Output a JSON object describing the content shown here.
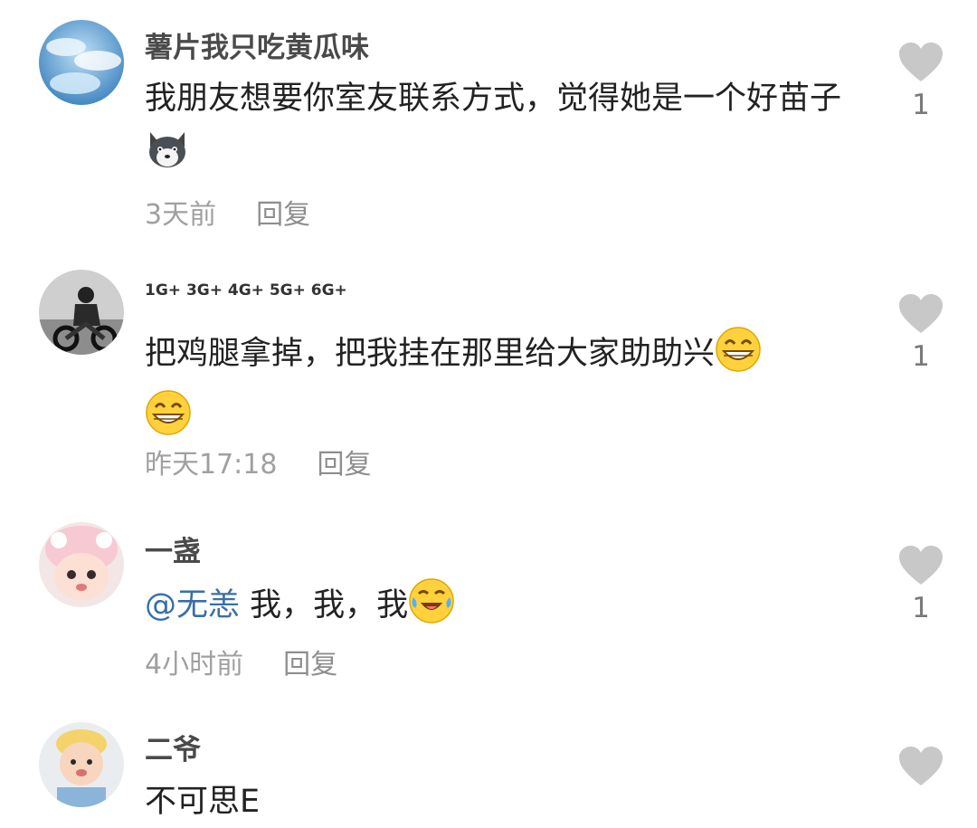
{
  "comments": [
    {
      "username": "薯片我只吃黄瓜味",
      "text": "我朋友想要你室友联系方式，觉得她是一个好苗子",
      "time": "3天前",
      "reply": "回复",
      "likes": "1"
    },
    {
      "username": "1G+ 3G+ 4G+ 5G+ 6G+",
      "text": "把鸡腿拿掉，把我挂在那里给大家助助兴",
      "time": "昨天17:18",
      "reply": "回复",
      "likes": "1"
    },
    {
      "username": "一盏",
      "mention": "@无恙",
      "text": " 我，我，我",
      "time": "4小时前",
      "reply": "回复",
      "likes": "1"
    },
    {
      "username": "二爷",
      "text": "不可思E",
      "likes": ""
    }
  ],
  "icons": {
    "like": "heart-icon",
    "emoji_wolf": "husky-emoji-icon",
    "emoji_grin": "grinning-emoji-icon",
    "emoji_cry_laugh": "crying-laughing-emoji-icon"
  },
  "colors": {
    "heart": "#c8c8c8",
    "mention": "#3a6fa6",
    "meta": "#a0a0a0"
  }
}
